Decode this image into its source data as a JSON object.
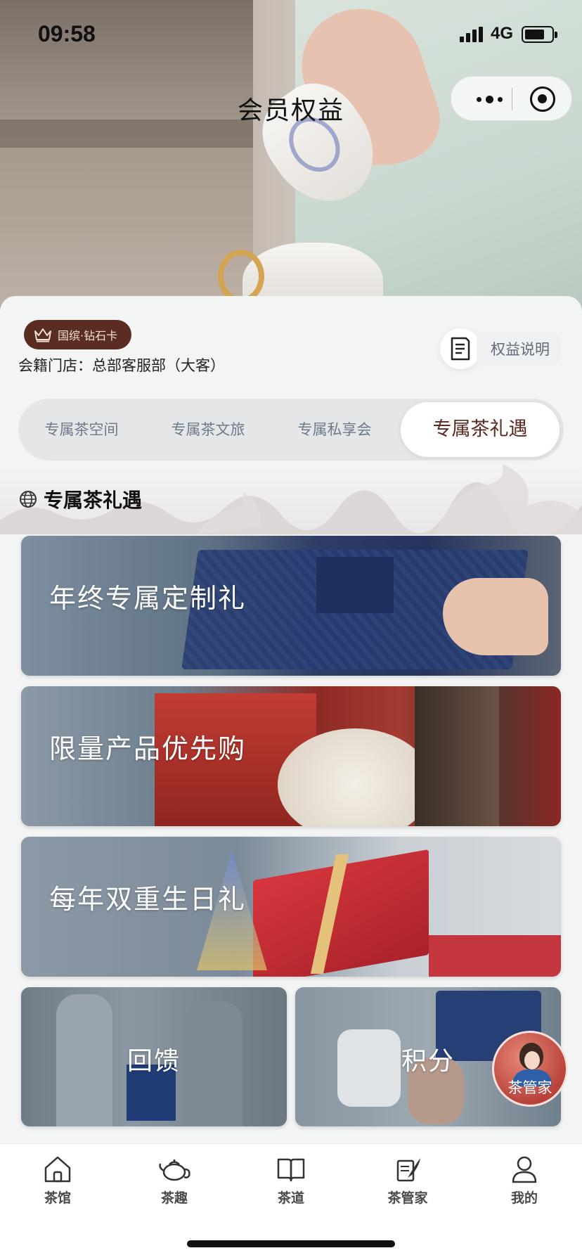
{
  "status_bar": {
    "time": "09:58",
    "network": "4G",
    "battery_level": 0.75
  },
  "nav": {
    "title": "会员权益"
  },
  "member": {
    "card_level": "国缤·钻石卡",
    "store_line": "会籍门店：总部客服部（大客）"
  },
  "benefit_info": {
    "label": "权益说明",
    "icon": "document-icon"
  },
  "tabs": [
    {
      "label": "专属茶空间",
      "active": false
    },
    {
      "label": "专属茶文旅",
      "active": false
    },
    {
      "label": "专属私享会",
      "active": false
    },
    {
      "label": "专属茶礼遇",
      "active": true
    }
  ],
  "section": {
    "title": "专属茶礼遇",
    "icon": "globe-icon"
  },
  "cards": [
    {
      "label": "年终专属定制礼"
    },
    {
      "label": "限量产品优先购"
    },
    {
      "label": "每年双重生日礼"
    },
    {
      "label": "回馈"
    },
    {
      "label": "积分"
    }
  ],
  "floating_button": {
    "label": "茶管家"
  },
  "bottom_nav": [
    {
      "label": "茶馆",
      "icon": "house-icon"
    },
    {
      "label": "茶趣",
      "icon": "teapot-icon"
    },
    {
      "label": "茶道",
      "icon": "book-icon"
    },
    {
      "label": "茶管家",
      "icon": "quill-icon"
    },
    {
      "label": "我的",
      "icon": "person-icon"
    }
  ]
}
